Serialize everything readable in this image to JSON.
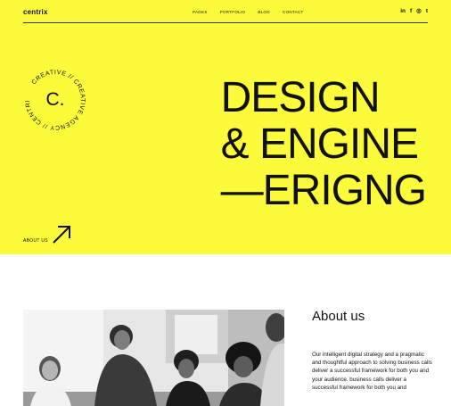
{
  "header": {
    "logo": "centrix",
    "menu": [
      "PAGES",
      "PORTFOLIO",
      "BLOG",
      "CONTACT"
    ],
    "social": [
      "in",
      "f",
      "◎",
      "t"
    ]
  },
  "badge": {
    "center": "C.",
    "ring_text": "CREATIVE // CREATIVE AGENCY // CENTRIX //"
  },
  "headline": [
    "DESIGN",
    "& ENGINE",
    "—ERIGNG"
  ],
  "about_link": "ABOUT US",
  "about": {
    "title": "About us",
    "body": " Our intelligent digital strategy and a pragmatic and thoughtful approach to solving business calls deliver a successful framework for both you and your audience. business calls deliver a successful framework for both you and"
  },
  "colors": {
    "hero_bg": "#fbfb3c",
    "text": "#111111"
  },
  "icons": {
    "arrow": "arrow-up-right-icon"
  }
}
